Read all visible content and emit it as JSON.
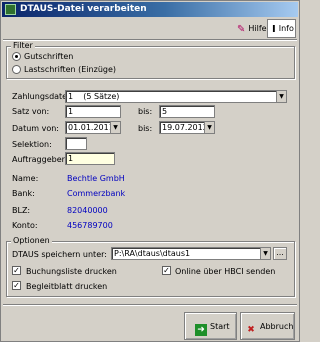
{
  "window": {
    "title": "DTAUS-Datei verarbeiten"
  },
  "toolbar": {
    "hilfe_label": "Hilfe",
    "info_label": "Info"
  },
  "filter": {
    "group_label": "Filter",
    "gutschriften_label": "Gutschriften",
    "lastschriften_label": "Lastschriften (Einzüge)",
    "selected": "Gutschriften"
  },
  "form": {
    "zahlungsdatei_label": "Zahlungsdatei:",
    "zahlungsdatei_value": "1",
    "zahlungsdatei_count": "(5 Sätze)",
    "satz_von_label": "Satz von:",
    "satz_von_value": "1",
    "bis_label": "bis:",
    "satz_bis_value": "5",
    "datum_von_label": "Datum von:",
    "datum_von_value": "01.01.2011",
    "datum_bis_value": "19.07.2012",
    "selektion_label": "Selektion:",
    "selektion_value": "",
    "auftraggeber_label": "Auftraggeber:",
    "auftraggeber_value": "1",
    "name_label": "Name:",
    "name_value": "Bechtle GmbH",
    "bank_label": "Bank:",
    "bank_value": "Commerzbank",
    "blz_label": "BLZ:",
    "blz_value": "82040000",
    "konto_label": "Konto:",
    "konto_value": "456789700"
  },
  "optionen": {
    "group_label": "Optionen",
    "speichern_label": "DTAUS speichern unter:",
    "speichern_value": "P:\\RA\\dtaus\\dtaus1",
    "browse_label": "...",
    "buchungsliste_label": "Buchungsliste drucken",
    "buchungsliste_checked": true,
    "begleitblatt_label": "Begleitblatt drucken",
    "begleitblatt_checked": true,
    "online_label": "Online über HBCI senden",
    "online_checked": true
  },
  "buttons": {
    "start_label": "Start",
    "abbruch_label": "Abbruch"
  },
  "colors": {
    "title_start": "#0a246a",
    "title_end": "#a6caf0",
    "value_blue": "#0000c0",
    "yellow_field": "#ffffe1"
  }
}
